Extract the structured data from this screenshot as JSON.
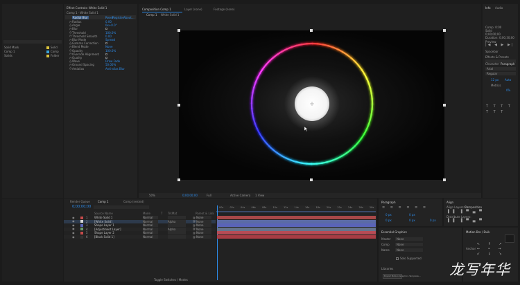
{
  "effects": {
    "header": "Effect Controls: White Solid 1",
    "layer_name": "Comp 1 · White Solid 1",
    "effect_name": "Radial Blur",
    "effect_links": [
      "Reset",
      "Register",
      "About..."
    ],
    "params": [
      {
        "label": "Radius",
        "value": "0.00"
      },
      {
        "label": "Angle",
        "value": "0x+0.0°"
      },
      {
        "label": "Blur",
        "value": ""
      },
      {
        "label": "Threshold",
        "value": "100.0%"
      },
      {
        "label": "Threshold Smooth",
        "value": "0.00"
      },
      {
        "label": "Blur Mode",
        "value": "Spread"
      },
      {
        "label": "Gamma Correction",
        "value": ""
      },
      {
        "label": "Blend Mode",
        "value": "None"
      },
      {
        "label": "Opacity",
        "value": "100.0%"
      },
      {
        "label": "Override Alignment",
        "value": ""
      },
      {
        "label": "Quality",
        "value": ""
      },
      {
        "label": "Wave",
        "value": "Draw Fade"
      },
      {
        "label": "Ground Spacing",
        "value": "50.00%"
      },
      {
        "label": "Antialias",
        "value": "Anti-alias Blur"
      }
    ]
  },
  "project": {
    "items": [
      {
        "name": "Solid Mask",
        "type": "Solid",
        "color": "#d9c23c"
      },
      {
        "name": "Comp 1",
        "type": "Comp",
        "color": "#3aa3d9"
      },
      {
        "name": "Solids",
        "type": "Folder",
        "color": "#d9c23c"
      }
    ]
  },
  "viewer": {
    "tabs": [
      {
        "label": "Composition Comp 1",
        "active": true
      },
      {
        "label": "Layer (none)",
        "active": false
      },
      {
        "label": "Footage (none)",
        "active": false
      }
    ],
    "breadcrumb": [
      "Comp 1",
      "White Solid 1"
    ],
    "zoom": "50%",
    "timecode": "0;00;00;00",
    "resolution": "Full",
    "view": "Active Camera",
    "views": "1 View"
  },
  "right_panel": {
    "tabs": [
      "Info",
      "Audio"
    ],
    "info_lines": [
      "Comp: 0:00",
      "Solid",
      "0;00;00;00",
      "Duration: 0;00;30;00"
    ],
    "preview_label": "Preview",
    "shortcut_label": "Spacebar",
    "effects_presets_label": "Effects & Presets",
    "character_tabs": [
      "Character",
      "Paragraph"
    ],
    "font_name": "Arial",
    "font_style": "Regular",
    "size_value": "12 px",
    "auto_value": "Auto",
    "metrics_label": "Metrics",
    "percent_value": "0%"
  },
  "timeline": {
    "tabs": [
      {
        "label": "Render Queue",
        "active": false
      },
      {
        "label": "Comp 1",
        "active": true
      },
      {
        "label": "Comp (nested)",
        "active": false
      }
    ],
    "timecode": "0;00;00;00",
    "columns": [
      "Source Name",
      "Mode",
      "T",
      "TrkMat",
      "Parent & Link"
    ],
    "layers": [
      {
        "num": "1",
        "name": "White Solid 1",
        "mode": "Normal",
        "trk": "",
        "parent": "None",
        "color": "#c64b4b",
        "bar": "#a84848"
      },
      {
        "num": "2",
        "name": "[White Solid]",
        "mode": "Normal",
        "trk": "Alpha",
        "parent": "None",
        "color": "#d6d6d6",
        "bar": "#5b6ba6"
      },
      {
        "num": "3",
        "name": "Shape Layer 1",
        "mode": "Normal",
        "trk": "",
        "parent": "None",
        "color": "#5a64b8",
        "bar": "#5a64b8"
      },
      {
        "num": "4",
        "name": "[Adjustment Layer]",
        "mode": "Normal",
        "trk": "Alpha",
        "parent": "None",
        "color": "#6a9a6a",
        "bar": "#66748c"
      },
      {
        "num": "5",
        "name": "Shape Layer 2",
        "mode": "Normal",
        "trk": "",
        "parent": "None",
        "color": "#c64b4b",
        "bar": "#b64c56"
      },
      {
        "num": "6",
        "name": "[Black Solid 1]",
        "mode": "Normal",
        "trk": "",
        "parent": "None",
        "color": "#333333",
        "bar": "#a83c44"
      }
    ],
    "ruler": [
      "00s",
      "02s",
      "04s",
      "06s",
      "08s",
      "10s",
      "12s",
      "14s",
      "16s",
      "18s",
      "20s",
      "22s",
      "24s",
      "26s",
      "28s"
    ],
    "footer": "Toggle Switches / Modes"
  },
  "paragraph": {
    "title": "Paragraph",
    "fields": [
      "0 px",
      "0 px",
      "0 px",
      "0 px",
      "0 px"
    ]
  },
  "align": {
    "title": "Align",
    "align_to_label": "Align Layers to:",
    "align_to_value": "Composition",
    "distribute_label": "Distribute Layers:"
  },
  "essential": {
    "title": "Essential Graphics",
    "rows": [
      {
        "label": "Master",
        "value": "None"
      },
      {
        "label": "Comp",
        "value": "None"
      },
      {
        "label": "Name",
        "value": "None"
      }
    ],
    "checkbox_label": "Solo Supported",
    "export_button": "Export Motion Graphics Template..."
  },
  "motion": {
    "title": "Motion Bro / Duik",
    "anchor_label": "Anchor"
  },
  "tools": {
    "label": "Libraries"
  },
  "watermark": "龙写年华"
}
